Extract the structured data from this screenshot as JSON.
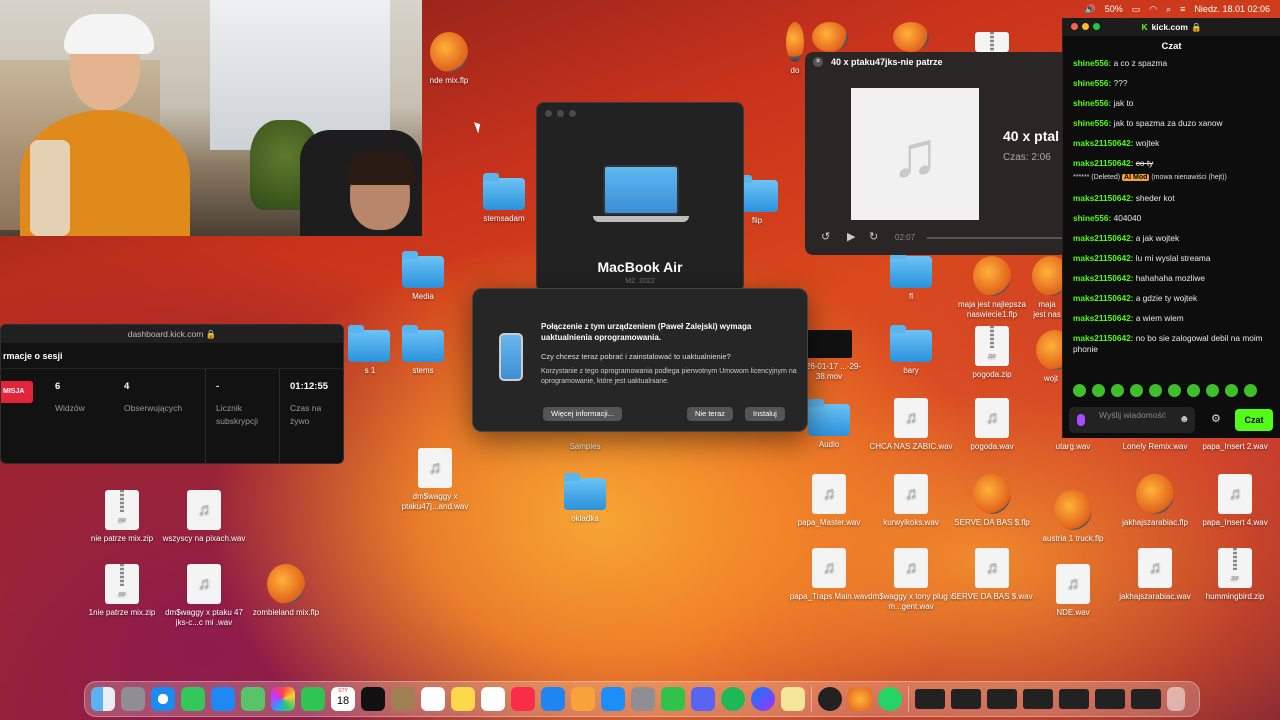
{
  "menubar": {
    "battery": "50%",
    "datetime": "Niedz. 18.01  02:06"
  },
  "desktop_icons": [
    {
      "id": "nde-mix",
      "label": "nde mix.flp",
      "type": "flp"
    },
    {
      "id": "stemsadam",
      "label": "stemsadam",
      "type": "folder"
    },
    {
      "id": "media",
      "label": "Media",
      "type": "folder"
    },
    {
      "id": "stems",
      "label": "stems",
      "type": "folder"
    },
    {
      "id": "samples",
      "label": "Samples",
      "type": "folder"
    },
    {
      "id": "okladka",
      "label": "okladka",
      "type": "folder"
    },
    {
      "id": "dmswaggy",
      "label": "dm$waggy x ptaku47j...and.wav",
      "type": "wav"
    },
    {
      "id": "nie-patrze-zip",
      "label": "nie patrze mix.zip",
      "type": "zip"
    },
    {
      "id": "wszyscy",
      "label": "wszyscy na pixach.wav",
      "type": "wav"
    },
    {
      "id": "1nie-patrze",
      "label": "1nie patrze mix.zip",
      "type": "zip"
    },
    {
      "id": "dmswaggy2",
      "label": "dm$waggy x ptaku 47 jks-c...c mi .wav",
      "type": "wav"
    },
    {
      "id": "zombieland",
      "label": "zombieland mix.flp",
      "type": "flp"
    },
    {
      "id": "fl",
      "label": "fl",
      "type": "folder"
    },
    {
      "id": "maja",
      "label": "maja jest najlepsza naswiecie1.flp",
      "type": "flp"
    },
    {
      "id": "bary",
      "label": "bary",
      "type": "folder"
    },
    {
      "id": "pogoda-zip",
      "label": "pogoda.zip",
      "type": "zip"
    },
    {
      "id": "mov",
      "label": "2026-01-17 ...-29-38.mov",
      "type": "mov"
    },
    {
      "id": "audio",
      "label": "Audio",
      "type": "folder"
    },
    {
      "id": "chca",
      "label": "CHCA NAS ZABIC.wav",
      "type": "wav"
    },
    {
      "id": "pogoda-wav",
      "label": "pogoda.wav",
      "type": "wav"
    },
    {
      "id": "utarg",
      "label": "utarg.wav",
      "type": "wav"
    },
    {
      "id": "lonely",
      "label": "Lonely Remix.wav",
      "type": "wav"
    },
    {
      "id": "papa-insert2",
      "label": "papa_Insert 2.wav",
      "type": "wav"
    },
    {
      "id": "papa-master",
      "label": "papa_Master.wav",
      "type": "wav"
    },
    {
      "id": "kurwyikoks",
      "label": "kurwyikoks.wav",
      "type": "wav"
    },
    {
      "id": "serve-flp",
      "label": "SERVE DA BAS $.flp",
      "type": "flp"
    },
    {
      "id": "austria",
      "label": "austria 1 truck.flp",
      "type": "flp"
    },
    {
      "id": "jakhajs-flp",
      "label": "jakhajszarabiac.flp",
      "type": "flp"
    },
    {
      "id": "papa-insert4",
      "label": "papa_Insert 4.wav",
      "type": "wav"
    },
    {
      "id": "papa-traps",
      "label": "papa_Traps Main.wav",
      "type": "wav"
    },
    {
      "id": "dmswaggy-tony",
      "label": "dm$waggy x tony plug x m...gent.wav",
      "type": "wav"
    },
    {
      "id": "serve-wav",
      "label": "SERVE DA BAS $.wav",
      "type": "wav"
    },
    {
      "id": "nde-wav",
      "label": "NDE.wav",
      "type": "wav"
    },
    {
      "id": "jakhajs-wav",
      "label": "jakhajszarabiac.wav",
      "type": "wav"
    },
    {
      "id": "hummingbird",
      "label": "hummingbird.zip",
      "type": "zip"
    },
    {
      "id": "s1",
      "label": "s 1",
      "type": "folder"
    },
    {
      "id": "flip",
      "label": "flip",
      "type": "folder"
    },
    {
      "id": "wojt",
      "label": "wojt",
      "type": "flp"
    },
    {
      "id": "maja2",
      "label": "maja jest nas",
      "type": "flp"
    },
    {
      "id": "do",
      "label": "do",
      "type": "flp"
    }
  ],
  "music_player": {
    "window_title": "40 x ptaku47jks-nie patrze",
    "track_title": "40 x ptal",
    "duration": "Czas: 2:06",
    "position": "02:07",
    "art_glyph": "♫"
  },
  "about_mac": {
    "model": "MacBook Air",
    "year": "M2, 2022"
  },
  "update_dialog": {
    "title": "Połączenie z tym urządzeniem (Paweł Zalejski) wymaga uaktualnienia oprogramowania.",
    "question": "Czy chcesz teraz pobrać i zainstalować to uaktualnienie?",
    "license": "Korzystanie z tego oprogramowania podlega pierwotnym Umowom licencyjnym na oprogramowanie, które jest uaktualniane.",
    "more_info": "Więcej informacji...",
    "not_now": "Nie teraz",
    "install": "Instaluj"
  },
  "dashboard": {
    "url": "dashboard.kick.com",
    "header": "rmacje o sesji",
    "badge": "MISJA",
    "viewers_value": "6",
    "viewers_label": "Widzów",
    "followers_value": "4",
    "followers_label": "Obserwujących",
    "subs_value": "-",
    "subs_label": "Licznik subskrypcji",
    "live_value": "01:12:55",
    "live_label": "Czas na żywo"
  },
  "chat": {
    "url": "kick.com",
    "title": "Czat",
    "messages": [
      {
        "user": "shine556:",
        "text": "a co z spazma"
      },
      {
        "user": "shine556:",
        "text": "???"
      },
      {
        "user": "shine556:",
        "text": "jak to"
      },
      {
        "user": "shine556:",
        "text": "jak to spazma za duzo xanow"
      },
      {
        "user": "maks21150642:",
        "text": "wojtek"
      },
      {
        "user": "maks21150642:",
        "text": "co ty"
      },
      {
        "user": "maks21150642:",
        "text": "sheder kot"
      },
      {
        "user": "shine556:",
        "text": "404040"
      },
      {
        "user": "maks21150642:",
        "text": "a jak wojtek"
      },
      {
        "user": "maks21150642:",
        "text": "lu mi wyslal streama"
      },
      {
        "user": "maks21150642:",
        "text": "hahahaha mozliwe"
      },
      {
        "user": "maks21150642:",
        "text": "a gdzie ty wojtek"
      },
      {
        "user": "maks21150642:",
        "text": "a wiem wiem"
      },
      {
        "user": "maks21150642:",
        "text": "no bo sie zalogowal debil na moim phonie"
      }
    ],
    "deleted_note": "****** (Deleted)",
    "ai_mod": "AI Mod",
    "mod_reason": "(mowa nienawiści (hejt))",
    "input_placeholder": "Wyślij wiadomość",
    "send_label": "Czat"
  },
  "dock": {
    "calendar_day": "18",
    "calendar_month": "STY",
    "apps": [
      "finder",
      "launchpad",
      "safari",
      "messages",
      "mail",
      "maps",
      "photos",
      "facetime",
      "calendar",
      "appletv",
      "notes-folder",
      "reminders",
      "notes",
      "freeform",
      "music",
      "keynote",
      "pages",
      "appstore",
      "settings",
      "numbers",
      "discord",
      "spotify",
      "messenger",
      "notes-yellow",
      "activity",
      "fl-studio",
      "whatsapp"
    ]
  }
}
